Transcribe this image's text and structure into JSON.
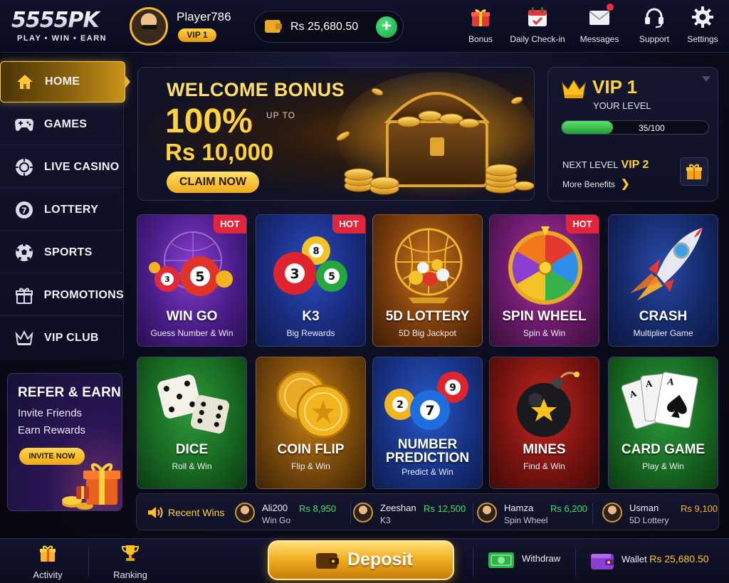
{
  "header": {
    "logo": "5555PK",
    "tagline": "PLAY • WIN • EARN",
    "player_name": "Player786",
    "vip_badge": "VIP 1",
    "balance": "Rs 25,680.50",
    "nav": [
      {
        "label": "Bonus",
        "icon": "gift-icon"
      },
      {
        "label": "Daily Check-in",
        "icon": "calendar-icon"
      },
      {
        "label": "Messages",
        "icon": "mail-icon"
      },
      {
        "label": "Support",
        "icon": "headset-icon"
      },
      {
        "label": "Settings",
        "icon": "gear-icon"
      }
    ]
  },
  "sidebar": {
    "items": [
      {
        "label": "HOME",
        "icon": "home-icon"
      },
      {
        "label": "GAMES",
        "icon": "gamepad-icon"
      },
      {
        "label": "LIVE CASINO",
        "icon": "casino-chip-icon"
      },
      {
        "label": "LOTTERY",
        "icon": "lottery-ball-icon"
      },
      {
        "label": "SPORTS",
        "icon": "soccer-ball-icon"
      },
      {
        "label": "PROMOTIONS",
        "icon": "gift-icon"
      },
      {
        "label": "VIP CLUB",
        "icon": "crown-icon"
      }
    ],
    "refer": {
      "title": "REFER & EARN",
      "line1": "Invite Friends",
      "line2": "Earn Rewards",
      "button": "INVITE NOW"
    }
  },
  "banner": {
    "title": "WELCOME BONUS",
    "percent": "100%",
    "upto": "UP TO",
    "amount": "Rs 10,000",
    "button": "CLAIM NOW"
  },
  "vip": {
    "level": "VIP 1",
    "subtitle": "YOUR LEVEL",
    "progress_text": "35/100",
    "progress_fraction": 0.35,
    "next_label": "NEXT LEVEL",
    "next_level": "VIP 2",
    "more": "More Benefits"
  },
  "games": [
    {
      "name": "WIN GO",
      "sub": "Guess Number & Win",
      "hot": "HOT"
    },
    {
      "name": "K3",
      "sub": "Big Rewards",
      "hot": "HOT"
    },
    {
      "name": "5D LOTTERY",
      "sub": "5D Big Jackpot"
    },
    {
      "name": "SPIN WHEEL",
      "sub": "Spin & Win",
      "hot": "HOT"
    },
    {
      "name": "CRASH",
      "sub": "Multiplier Game"
    },
    {
      "name": "DICE",
      "sub": "Roll & Win"
    },
    {
      "name": "COIN FLIP",
      "sub": "Flip & Win"
    },
    {
      "name": "NUMBER PREDICTION",
      "name1": "NUMBER",
      "name2": "PREDICTION",
      "sub": "Predict & Win"
    },
    {
      "name": "MINES",
      "sub": "Find & Win"
    },
    {
      "name": "CARD GAME",
      "sub": "Play & Win"
    }
  ],
  "recent_wins": {
    "title": "Recent Wins",
    "items": [
      {
        "user": "Ali200",
        "game": "Win Go",
        "amount": "Rs 8,950"
      },
      {
        "user": "Zeeshan",
        "game": "K3",
        "amount": "Rs 12,500"
      },
      {
        "user": "Hamza",
        "game": "Spin Wheel",
        "amount": "Rs 6,200"
      },
      {
        "user": "Usman",
        "game": "5D Lottery",
        "amount": "Rs 9,100"
      }
    ]
  },
  "bottom": {
    "activity": "Activity",
    "ranking": "Ranking",
    "deposit": "Deposit",
    "withdraw": "Withdraw",
    "wallet": "Wallet",
    "wallet_amount": "Rs 25,680.50"
  },
  "colors": {
    "gold": "#ffd23a",
    "hot_red": "#e3243a",
    "win_green": "#3fe06a",
    "accent_bg": "#0b0c1c"
  }
}
